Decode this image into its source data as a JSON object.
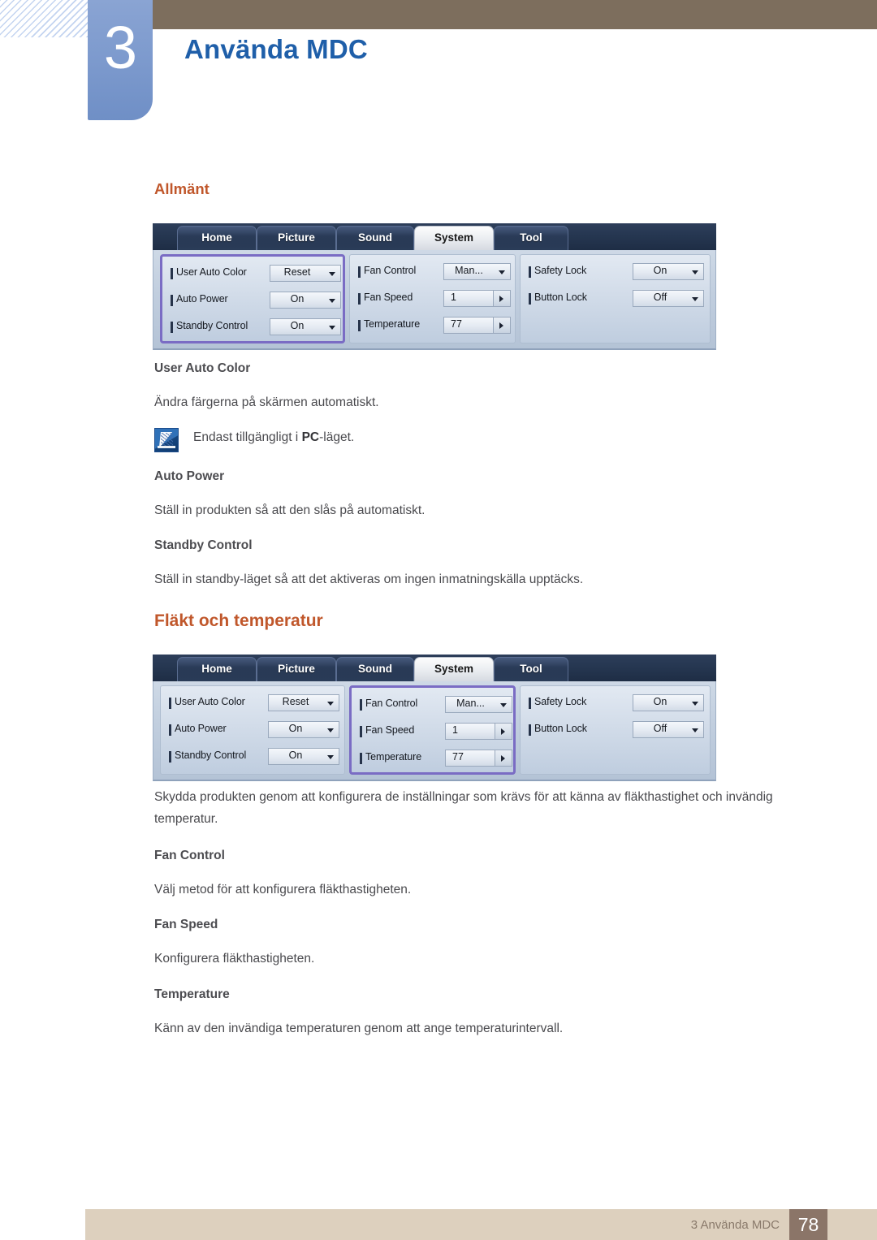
{
  "header": {
    "chapter_number": "3",
    "chapter_title": "Använda MDC"
  },
  "sections": {
    "allmant": {
      "heading": "Allmänt",
      "blocks": [
        {
          "title": "User Auto Color",
          "body": "Ändra färgerna på skärmen automatiskt."
        },
        {
          "title": "Auto Power",
          "body": "Ställ in produkten så att den slås på automatiskt."
        },
        {
          "title": "Standby Control",
          "body": "Ställ in standby-läget så att det aktiveras om ingen inmatningskälla upptäcks."
        }
      ],
      "note": {
        "icon": "note-pen-icon",
        "prefix": "Endast tillgängligt i ",
        "bold": "PC",
        "suffix": "-läget."
      }
    },
    "flakt": {
      "heading": "Fläkt och temperatur",
      "intro": "Skydda produkten genom att konfigurera de inställningar som krävs för att känna av fläkthastighet och invändig temperatur.",
      "blocks": [
        {
          "title": "Fan Control",
          "body": "Välj metod för att konfigurera fläkthastigheten."
        },
        {
          "title": "Fan Speed",
          "body": "Konfigurera fläkthastigheten."
        },
        {
          "title": "Temperature",
          "body": "Känn av den invändiga temperaturen genom att ange temperaturintervall."
        }
      ]
    }
  },
  "mdc_panel": {
    "tabs": [
      {
        "label": "Home",
        "active": false
      },
      {
        "label": "Picture",
        "active": false
      },
      {
        "label": "Sound",
        "active": false
      },
      {
        "label": "System",
        "active": true
      },
      {
        "label": "Tool",
        "active": false
      }
    ],
    "groups": {
      "general": [
        {
          "label": "User Auto Color",
          "value": "Reset",
          "control": "dropdown"
        },
        {
          "label": "Auto Power",
          "value": "On",
          "control": "dropdown"
        },
        {
          "label": "Standby Control",
          "value": "On",
          "control": "dropdown"
        }
      ],
      "fan": [
        {
          "label": "Fan Control",
          "value": "Man...",
          "control": "dropdown"
        },
        {
          "label": "Fan Speed",
          "value": "1",
          "control": "spinner"
        },
        {
          "label": "Temperature",
          "value": "77",
          "control": "spinner"
        }
      ],
      "lock": [
        {
          "label": "Safety Lock",
          "value": "On",
          "control": "dropdown"
        },
        {
          "label": "Button Lock",
          "value": "Off",
          "control": "dropdown"
        }
      ]
    },
    "highlight_first": "general",
    "highlight_second": "fan"
  },
  "footer": {
    "label": "3 Använda MDC",
    "page": "78"
  },
  "colors": {
    "accent_orange": "#c0572b",
    "chapter_blue": "#1f5fa9",
    "badge_blue": "#7e9bce",
    "brown_bar": "#7d6e5d",
    "footer_bar": "#ddd0be",
    "footer_page_box": "#8b7568",
    "highlight_purple": "#7a6cc4"
  }
}
